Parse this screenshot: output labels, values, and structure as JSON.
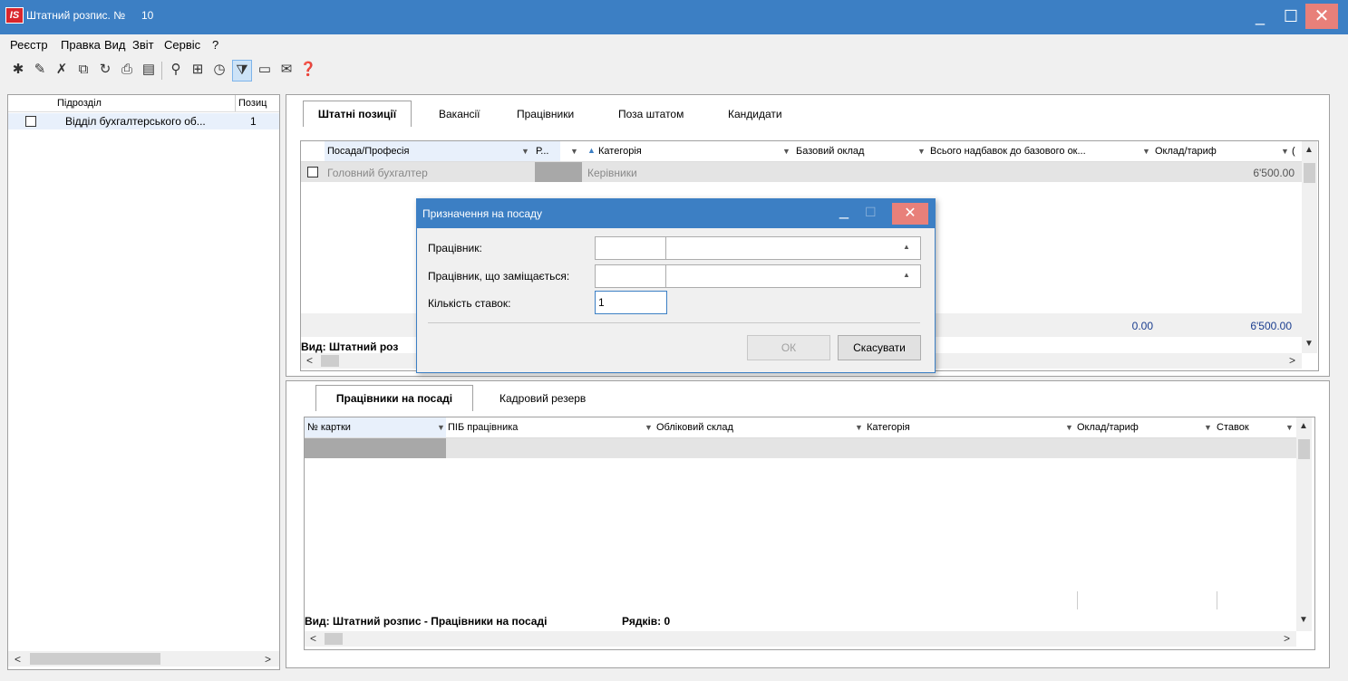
{
  "window": {
    "title": "Штатний розпис. №",
    "number": "10",
    "logo": "IS",
    "min_icon": "_",
    "max_icon": "☐",
    "close_icon": "✕"
  },
  "menu": [
    "Реєстр",
    "Правка",
    "Вид",
    "Звіт",
    "Сервіс",
    "?"
  ],
  "toolbar": {
    "icons": [
      "new-icon",
      "edit-icon",
      "delete-icon",
      "copy-icon",
      "refresh-icon",
      "print-icon",
      "print-preview-icon",
      "search-icon",
      "table-icon",
      "calendar-icon",
      "filter-icon",
      "form-icon",
      "mail-icon",
      "help-icon"
    ]
  },
  "left": {
    "col_subdivision": "Підрозділ",
    "col_positions": "Позиц",
    "rows": [
      {
        "name": "Відділ бухгалтерського об...",
        "count": "1"
      }
    ],
    "scroll_left": "<",
    "scroll_right": ">"
  },
  "top_tabs": [
    "Штатні позиції",
    "Вакансії",
    "Працівники",
    "Поза штатом",
    "Кандидати"
  ],
  "top_grid": {
    "headers": [
      "Посада/Професія",
      "Р...",
      "Категорія",
      "Базовий оклад",
      "Всього надбавок до базового ок...",
      "Оклад/тариф",
      "("
    ],
    "row": {
      "position": "Головний бухгалтер",
      "category": "Керівники",
      "salary": "6'500.00"
    },
    "totals": {
      "allowances": "0.00",
      "salary": "6'500.00"
    },
    "view_label": "Вид: Штатний роз"
  },
  "bottom_tabs": [
    "Працівники на посаді",
    "Кадровий резерв"
  ],
  "bottom_grid": {
    "headers": [
      "№ картки",
      "ПІБ працівника",
      "Обліковий склад",
      "Категорія",
      "Оклад/тариф",
      "Ставок"
    ],
    "view_label": "Вид: Штатний розпис - Працівники на посаді",
    "rows_label": "Рядків: 0"
  },
  "dialog": {
    "title": "Призначення на посаду",
    "employee_label": "Працівник:",
    "replaced_label": "Працівник, що заміщається:",
    "rate_label": "Кількість ставок:",
    "rate_value": "1",
    "ok_label": "ОК",
    "cancel_label": "Скасувати"
  }
}
